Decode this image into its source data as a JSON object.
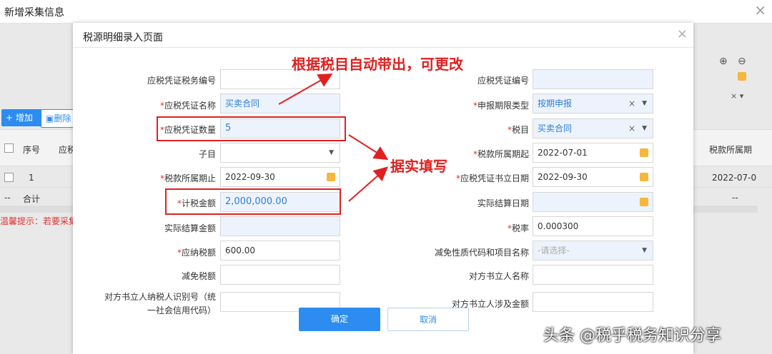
{
  "background": {
    "window_title": "新增采集信息",
    "add_button": "增加",
    "delete_button": "删除",
    "col_index": "序号",
    "col_partial": "应税",
    "col_right": "税款所属期",
    "row_index": "1",
    "row_total_dash": "--",
    "row_total_label": "合计",
    "row_right_value": "2022-07-0",
    "row_right_dash": "--",
    "hint": "温馨提示：若要采集"
  },
  "modal": {
    "title": "税源明细录入页面",
    "confirm": "确定",
    "cancel": "取消",
    "left": [
      {
        "label": "应税凭证税务编号",
        "required": false,
        "value": ""
      },
      {
        "label": "应税凭证名称",
        "required": true,
        "value": "买卖合同"
      },
      {
        "label": "应税凭证数量",
        "required": true,
        "value": "5"
      },
      {
        "label": "子目",
        "required": false,
        "value": ""
      },
      {
        "label": "税款所属期止",
        "required": true,
        "value": "2022-09-30"
      },
      {
        "label": "计税金额",
        "required": true,
        "value": "2,000,000.00"
      },
      {
        "label": "实际结算金额",
        "required": false,
        "value": ""
      },
      {
        "label": "应纳税额",
        "required": true,
        "value": "600.00"
      },
      {
        "label": "减免税额",
        "required": false,
        "value": ""
      },
      {
        "label": "对方书立人纳税人识别号（统",
        "label2": "一社会信用代码）",
        "required": false,
        "value": ""
      }
    ],
    "right": [
      {
        "label": "应税凭证编号",
        "required": false,
        "value": ""
      },
      {
        "label": "申报期限类型",
        "required": true,
        "value": "按期申报"
      },
      {
        "label": "税目",
        "required": true,
        "value": "买卖合同"
      },
      {
        "label": "税款所属期起",
        "required": true,
        "value": "2022-07-01"
      },
      {
        "label": "应税凭证书立日期",
        "required": true,
        "value": "2022-09-30"
      },
      {
        "label": "实际结算日期",
        "required": false,
        "value": ""
      },
      {
        "label": "税率",
        "required": true,
        "value": "0.000300"
      },
      {
        "label": "减免性质代码和项目名称",
        "required": false,
        "placeholder": "-请选择-"
      },
      {
        "label": "对方书立人名称",
        "required": false,
        "value": ""
      },
      {
        "label": "对方书立人涉及金额",
        "required": false,
        "value": ""
      }
    ]
  },
  "annotations": {
    "top": "根据税目自动带出，可更改",
    "middle": "据实填写",
    "color": "#e02020"
  },
  "watermark": "头条 @税乎税务知识分享",
  "colors": {
    "primary": "#2d8cf0",
    "required": "#e03030",
    "readonly_bg": "#edf3fc"
  }
}
